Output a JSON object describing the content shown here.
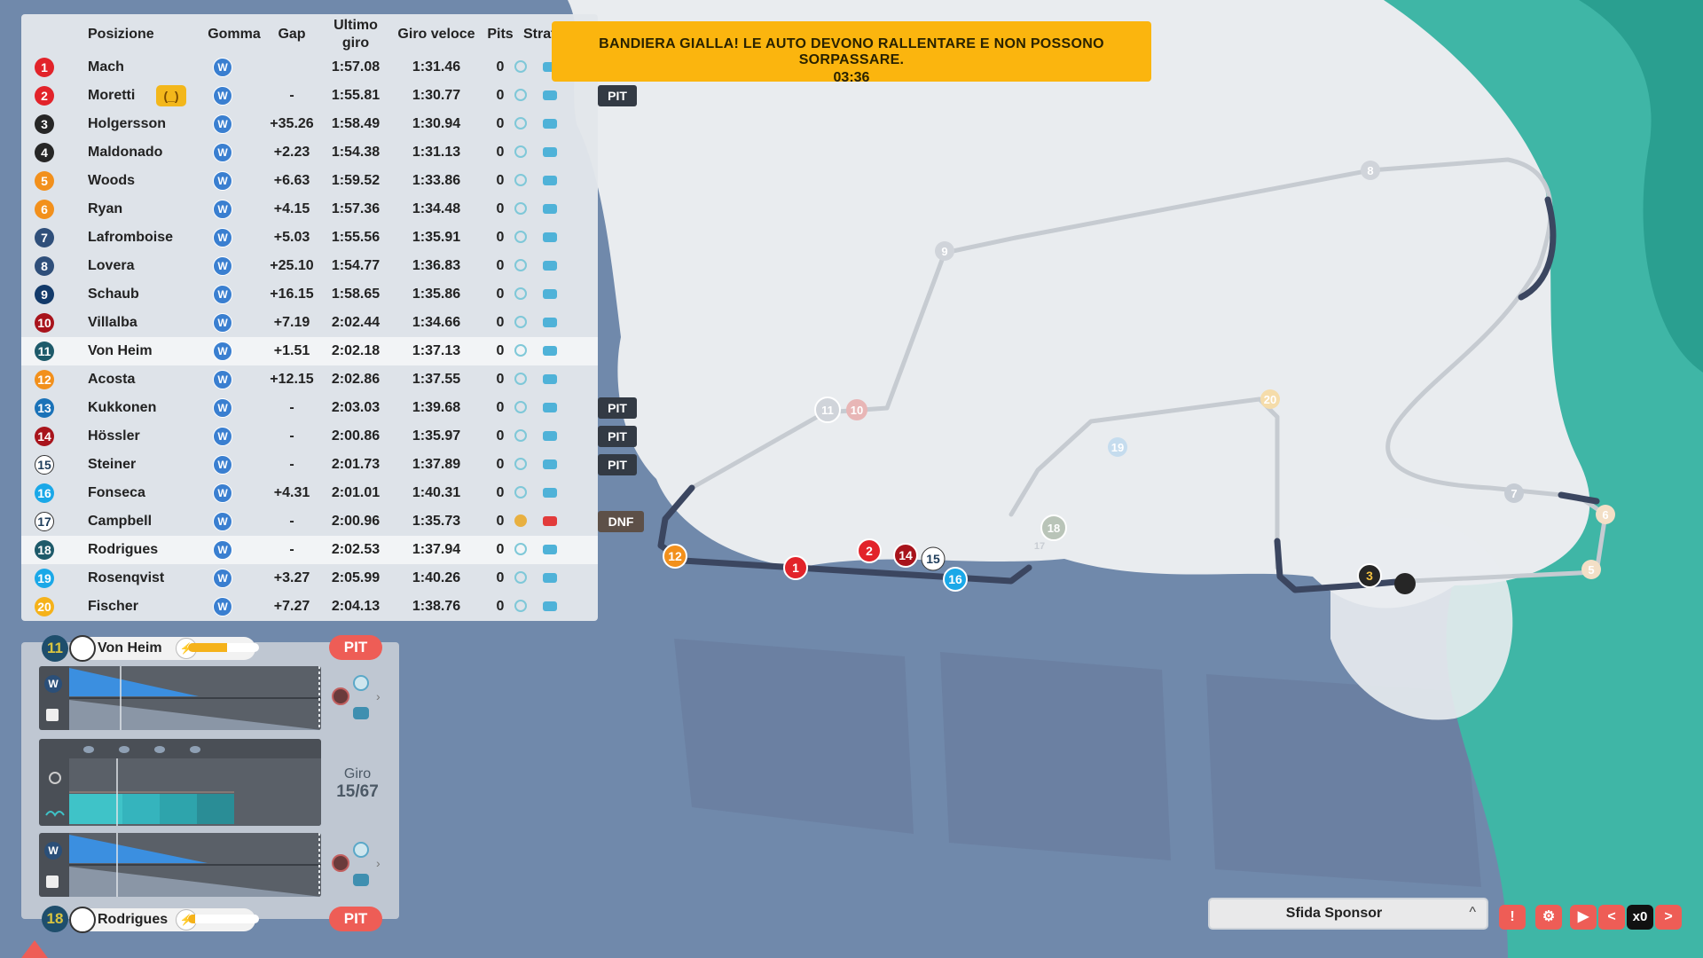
{
  "banner": {
    "line1": "BANDIERA GIALLA! LE AUTO DEVONO RALLENTARE E NON POSSONO SORPASSARE.",
    "line2": "03:36"
  },
  "standings": {
    "headers": {
      "position": "Posizione",
      "tyre": "Gomma",
      "gap": "Gap",
      "last_lap_1": "Ultimo",
      "last_lap_2": "giro",
      "fastest_lap": "Giro veloce",
      "pits": "Pits",
      "strategy": "Strateg"
    },
    "rows": [
      {
        "pos": "1",
        "color": "#e2232a",
        "name": "Mach",
        "tyre": "W",
        "gap": "",
        "last": "1:57.08",
        "best": "1:31.46",
        "pits": "0",
        "tag": ""
      },
      {
        "pos": "2",
        "color": "#e2232a",
        "name": "Moretti",
        "tyre": "W",
        "gap": "-",
        "last": "1:55.81",
        "best": "1:30.77",
        "pits": "0",
        "tag": "PIT",
        "badge": "(_)"
      },
      {
        "pos": "3",
        "color": "#262626",
        "name": "Holgersson",
        "tyre": "W",
        "gap": "+35.26",
        "last": "1:58.49",
        "best": "1:30.94",
        "pits": "0",
        "tag": ""
      },
      {
        "pos": "4",
        "color": "#262626",
        "name": "Maldonado",
        "tyre": "W",
        "gap": "+2.23",
        "last": "1:54.38",
        "best": "1:31.13",
        "pits": "0",
        "tag": ""
      },
      {
        "pos": "5",
        "color": "#f2901c",
        "name": "Woods",
        "tyre": "W",
        "gap": "+6.63",
        "last": "1:59.52",
        "best": "1:33.86",
        "pits": "0",
        "tag": ""
      },
      {
        "pos": "6",
        "color": "#f2901c",
        "name": "Ryan",
        "tyre": "W",
        "gap": "+4.15",
        "last": "1:57.36",
        "best": "1:34.48",
        "pits": "0",
        "tag": ""
      },
      {
        "pos": "7",
        "color": "#2f4f7a",
        "name": "Lafromboise",
        "tyre": "W",
        "gap": "+5.03",
        "last": "1:55.56",
        "best": "1:35.91",
        "pits": "0",
        "tag": ""
      },
      {
        "pos": "8",
        "color": "#2f4f7a",
        "name": "Lovera",
        "tyre": "W",
        "gap": "+25.10",
        "last": "1:54.77",
        "best": "1:36.83",
        "pits": "0",
        "tag": ""
      },
      {
        "pos": "9",
        "color": "#123a6a",
        "name": "Schaub",
        "tyre": "W",
        "gap": "+16.15",
        "last": "1:58.65",
        "best": "1:35.86",
        "pits": "0",
        "tag": ""
      },
      {
        "pos": "10",
        "color": "#a8141c",
        "name": "Villalba",
        "tyre": "W",
        "gap": "+7.19",
        "last": "2:02.44",
        "best": "1:34.66",
        "pits": "0",
        "tag": ""
      },
      {
        "pos": "11",
        "color": "#1e5a6a",
        "name": "Von Heim",
        "tyre": "W",
        "gap": "+1.51",
        "last": "2:02.18",
        "best": "1:37.13",
        "pits": "0",
        "tag": "",
        "hl": true
      },
      {
        "pos": "12",
        "color": "#f2901c",
        "name": "Acosta",
        "tyre": "W",
        "gap": "+12.15",
        "last": "2:02.86",
        "best": "1:37.55",
        "pits": "0",
        "tag": ""
      },
      {
        "pos": "13",
        "color": "#1a72b8",
        "name": "Kukkonen",
        "tyre": "W",
        "gap": "-",
        "last": "2:03.03",
        "best": "1:39.68",
        "pits": "0",
        "tag": "PIT"
      },
      {
        "pos": "14",
        "color": "#a8141c",
        "name": "Hössler",
        "tyre": "W",
        "gap": "-",
        "last": "2:00.86",
        "best": "1:35.97",
        "pits": "0",
        "tag": "PIT"
      },
      {
        "pos": "15",
        "color": "#ffffff",
        "name": "Steiner",
        "tyre": "W",
        "gap": "-",
        "last": "2:01.73",
        "best": "1:37.89",
        "pits": "0",
        "tag": "PIT",
        "dark": true
      },
      {
        "pos": "16",
        "color": "#1aa8e8",
        "name": "Fonseca",
        "tyre": "W",
        "gap": "+4.31",
        "last": "2:01.01",
        "best": "1:40.31",
        "pits": "0",
        "tag": ""
      },
      {
        "pos": "17",
        "color": "#ffffff",
        "name": "Campbell",
        "tyre": "W",
        "gap": "-",
        "last": "2:00.96",
        "best": "1:35.73",
        "pits": "0",
        "tag": "DNF",
        "dark": true,
        "dnf": true
      },
      {
        "pos": "18",
        "color": "#1e5a6a",
        "name": "Rodrigues",
        "tyre": "W",
        "gap": "-",
        "last": "2:02.53",
        "best": "1:37.94",
        "pits": "0",
        "tag": "",
        "hl": true
      },
      {
        "pos": "19",
        "color": "#1aa8e8",
        "name": "Rosenqvist",
        "tyre": "W",
        "gap": "+3.27",
        "last": "2:05.99",
        "best": "1:40.26",
        "pits": "0",
        "tag": ""
      },
      {
        "pos": "20",
        "color": "#f5b21a",
        "name": "Fischer",
        "tyre": "W",
        "gap": "+7.27",
        "last": "2:04.13",
        "best": "1:38.76",
        "pits": "0",
        "tag": ""
      }
    ]
  },
  "driver_top": {
    "number": "11",
    "name": "Von Heim",
    "energy": 0.55,
    "pit_label": "PIT"
  },
  "driver_bottom": {
    "number": "18",
    "name": "Rodrigues",
    "energy": 0.1,
    "pit_label": "PIT"
  },
  "lap": {
    "label": "Giro",
    "value": "15/67"
  },
  "sponsor": {
    "label": "Sfida Sponsor",
    "chevron": "^"
  },
  "controls": {
    "info": "!",
    "settings": "⚙",
    "play": "▶",
    "slower": "<",
    "speed": "x0",
    "faster": ">"
  },
  "map_markers": [
    "1",
    "2",
    "14",
    "15",
    "16",
    "12",
    "3",
    "11",
    "10",
    "18",
    "17",
    "19",
    "20",
    "9",
    "8",
    "7",
    "6",
    "5"
  ],
  "colors": {
    "banner": "#fbb50e",
    "pit_button": "#ee5d56",
    "tyre_wet": "#3a7fd0"
  }
}
